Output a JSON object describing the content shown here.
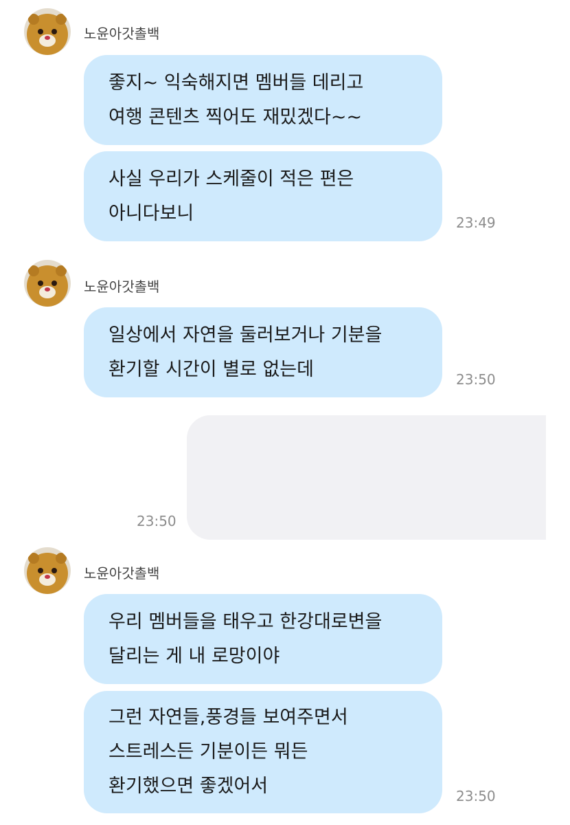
{
  "sender_name": "노윤아갓촐백",
  "avatar_icon": "hamster-plush-icon",
  "colors": {
    "incoming_bubble": "#cfeafd",
    "outgoing_bubble": "#f1f1f4",
    "timestamp": "#8c8c8c"
  },
  "groups": [
    {
      "sender": "노윤아갓촐백",
      "messages": [
        {
          "lines": [
            "좋지~ 익숙해지면 멤버들 데리고",
            "여행 콘텐츠 찍어도 재밌겠다~~"
          ]
        },
        {
          "lines": [
            "사실 우리가 스케줄이 적은 편은",
            "아니다보니"
          ],
          "time": "23:49"
        }
      ]
    },
    {
      "sender": "노윤아갓촐백",
      "messages": [
        {
          "lines": [
            "일상에서 자연을 둘러보거나 기분을",
            "환기할 시간이 별로 없는데"
          ],
          "time": "23:50"
        }
      ]
    },
    {
      "outgoing": true,
      "time": "23:50"
    },
    {
      "sender": "노윤아갓촐백",
      "messages": [
        {
          "lines": [
            "우리 멤버들을 태우고 한강대로변을",
            "달리는 게 내 로망이야"
          ]
        },
        {
          "lines": [
            "그런 자연들,풍경들 보여주면서",
            "스트레스든 기분이든 뭐든",
            "환기했으면 좋겠어서"
          ],
          "time": "23:50"
        }
      ]
    }
  ]
}
